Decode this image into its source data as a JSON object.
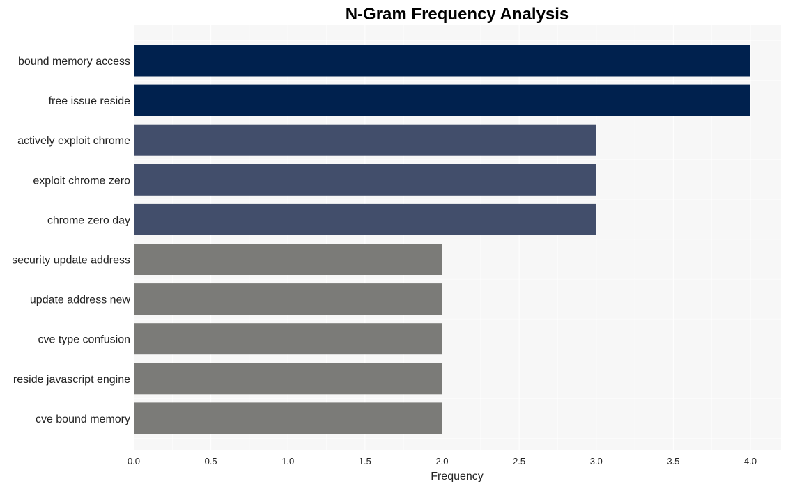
{
  "chart_data": {
    "type": "bar",
    "orientation": "horizontal",
    "title": "N-Gram Frequency Analysis",
    "xlabel": "Frequency",
    "ylabel": "",
    "xlim": [
      0,
      4.2
    ],
    "xticks": [
      "0.0",
      "0.5",
      "1.0",
      "1.5",
      "2.0",
      "2.5",
      "3.0",
      "3.5",
      "4.0"
    ],
    "grid": true,
    "categories": [
      "bound memory access",
      "free issue reside",
      "actively exploit chrome",
      "exploit chrome zero",
      "chrome zero day",
      "security update address",
      "update address new",
      "cve type confusion",
      "reside javascript engine",
      "cve bound memory"
    ],
    "values": [
      4,
      4,
      3,
      3,
      3,
      2,
      2,
      2,
      2,
      2
    ],
    "colors": {
      "4": "#00214e",
      "3": "#424e6b",
      "2": "#7b7b78"
    },
    "background": "#f7f7f7",
    "gridline_color": "#ffffff"
  }
}
